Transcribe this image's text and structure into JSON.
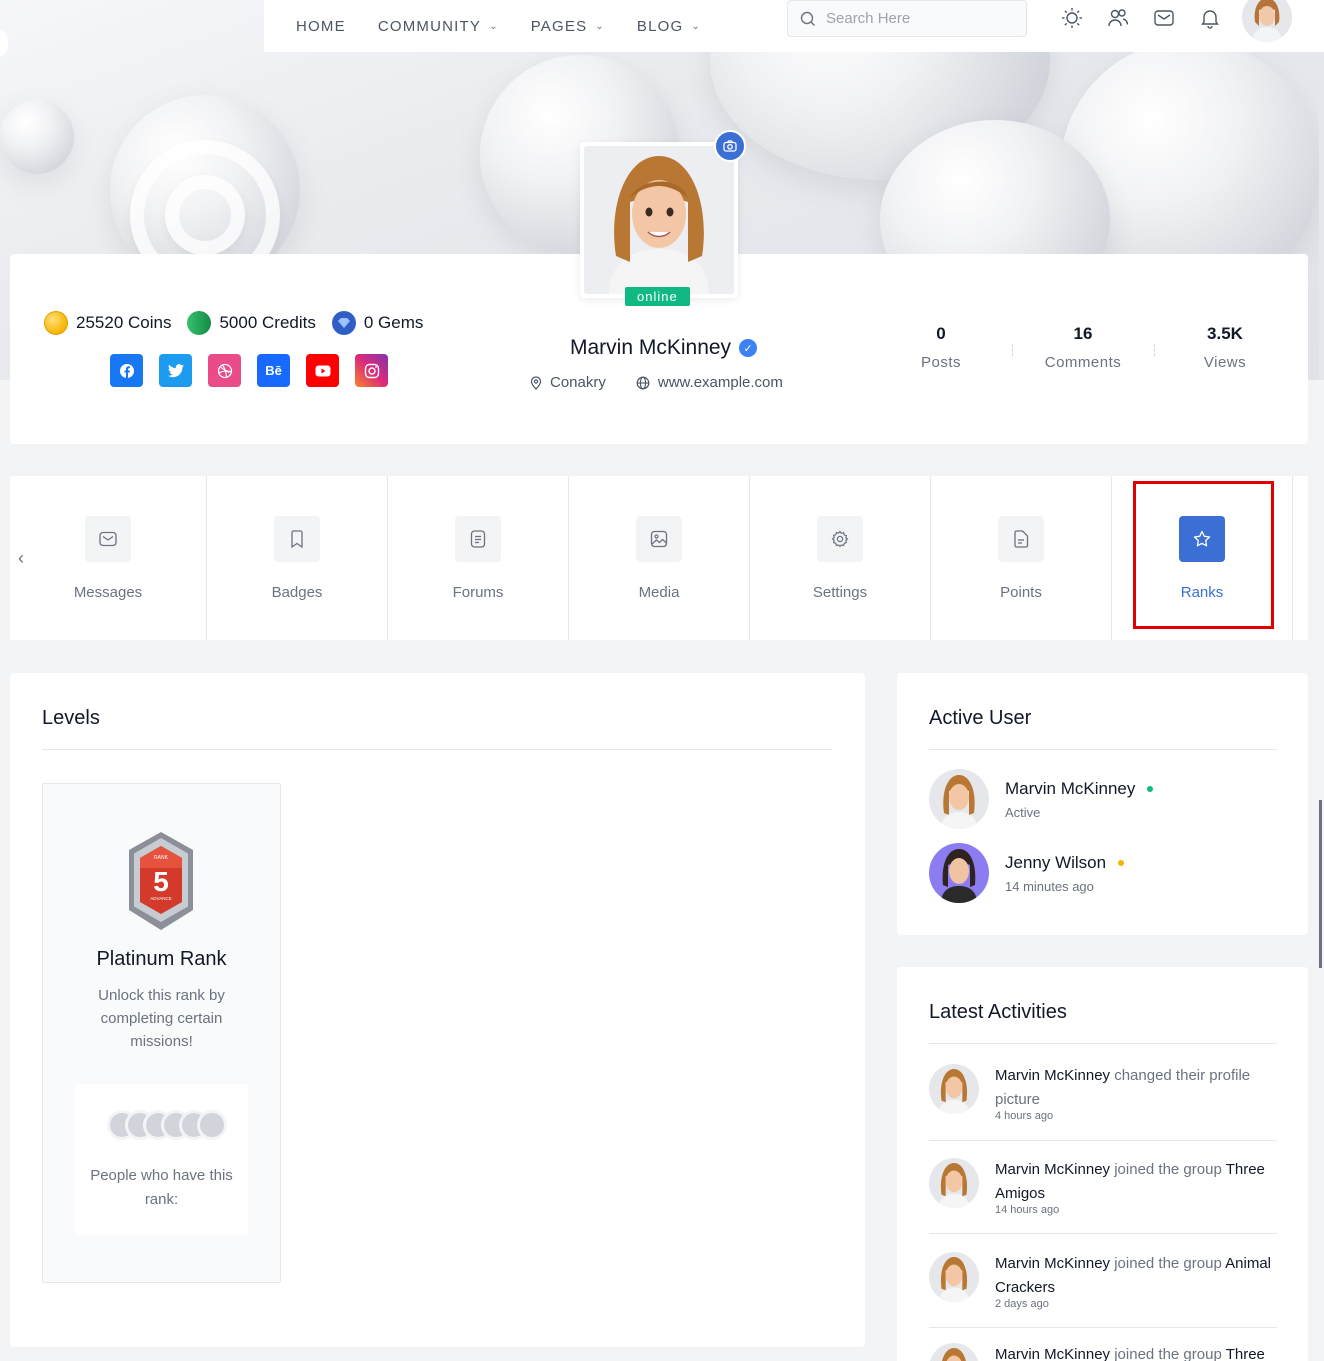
{
  "nav": {
    "items": [
      {
        "label": "HOME",
        "has_dropdown": false
      },
      {
        "label": "COMMUNITY",
        "has_dropdown": true
      },
      {
        "label": "PAGES",
        "has_dropdown": true
      },
      {
        "label": "BLOG",
        "has_dropdown": true
      }
    ],
    "search_placeholder": "Search Here",
    "icons": [
      "sun-icon",
      "users-icon",
      "mail-icon",
      "bell-icon"
    ]
  },
  "profile": {
    "status": "online",
    "name": "Marvin McKinney",
    "location": "Conakry",
    "website": "www.example.com",
    "currencies": [
      {
        "label": "25520 Coins",
        "icon": "coin-icon",
        "color": "#f5b400"
      },
      {
        "label": "5000 Credits",
        "icon": "credit-icon",
        "color": "#22a35a"
      },
      {
        "label": "0 Gems",
        "icon": "gem-icon",
        "color": "#2f5fc4"
      }
    ],
    "socials": [
      {
        "name": "facebook-icon",
        "color": "#1877f2",
        "glyph": "f"
      },
      {
        "name": "twitter-icon",
        "color": "#1d9bf0",
        "glyph": "t"
      },
      {
        "name": "dribbble-icon",
        "color": "#ea4c89",
        "glyph": "◎"
      },
      {
        "name": "behance-icon",
        "color": "#1769ff",
        "glyph": "Bē"
      },
      {
        "name": "youtube-icon",
        "color": "#ff0000",
        "glyph": "▶"
      },
      {
        "name": "instagram-icon",
        "color": "#e1306c",
        "glyph": "◻"
      }
    ],
    "stats": [
      {
        "value": "0",
        "label": "Posts"
      },
      {
        "value": "16",
        "label": "Comments"
      },
      {
        "value": "3.5K",
        "label": "Views"
      }
    ]
  },
  "tabs": [
    {
      "label": "Messages",
      "icon": "mail-icon",
      "active": false
    },
    {
      "label": "Badges",
      "icon": "bookmark-icon",
      "active": false
    },
    {
      "label": "Forums",
      "icon": "document-icon",
      "active": false
    },
    {
      "label": "Media",
      "icon": "image-icon",
      "active": false
    },
    {
      "label": "Settings",
      "icon": "gear-icon",
      "active": false
    },
    {
      "label": "Points",
      "icon": "file-icon",
      "active": false
    },
    {
      "label": "Ranks",
      "icon": "star-icon",
      "active": true
    }
  ],
  "levels": {
    "title": "Levels",
    "rank": {
      "badge_number": "5",
      "badge_top": "RANK",
      "badge_bottom": "ADVANCE",
      "title": "Platinum Rank",
      "description": "Unlock this rank by completing certain missions!",
      "people_label": "People who have this rank:"
    }
  },
  "active_users": {
    "title": "Active User",
    "users": [
      {
        "name": "Marvin McKinney",
        "status": "Active",
        "dot_color": "#10b981"
      },
      {
        "name": "Jenny Wilson",
        "status": "14 minutes ago",
        "dot_color": "#f5b400"
      }
    ]
  },
  "activities": {
    "title": "Latest Activities",
    "items": [
      {
        "actor": "Marvin McKinney",
        "action": " changed their profile picture",
        "target": "",
        "time": "4 hours ago"
      },
      {
        "actor": "Marvin McKinney",
        "action": " joined the group ",
        "target": "Three Amigos",
        "time": "14 hours ago"
      },
      {
        "actor": "Marvin McKinney",
        "action": " joined the group ",
        "target": "Animal Crackers",
        "time": "2 days ago"
      },
      {
        "actor": "Marvin McKinney",
        "action": " joined the group ",
        "target": "Three",
        "time": ""
      }
    ]
  }
}
